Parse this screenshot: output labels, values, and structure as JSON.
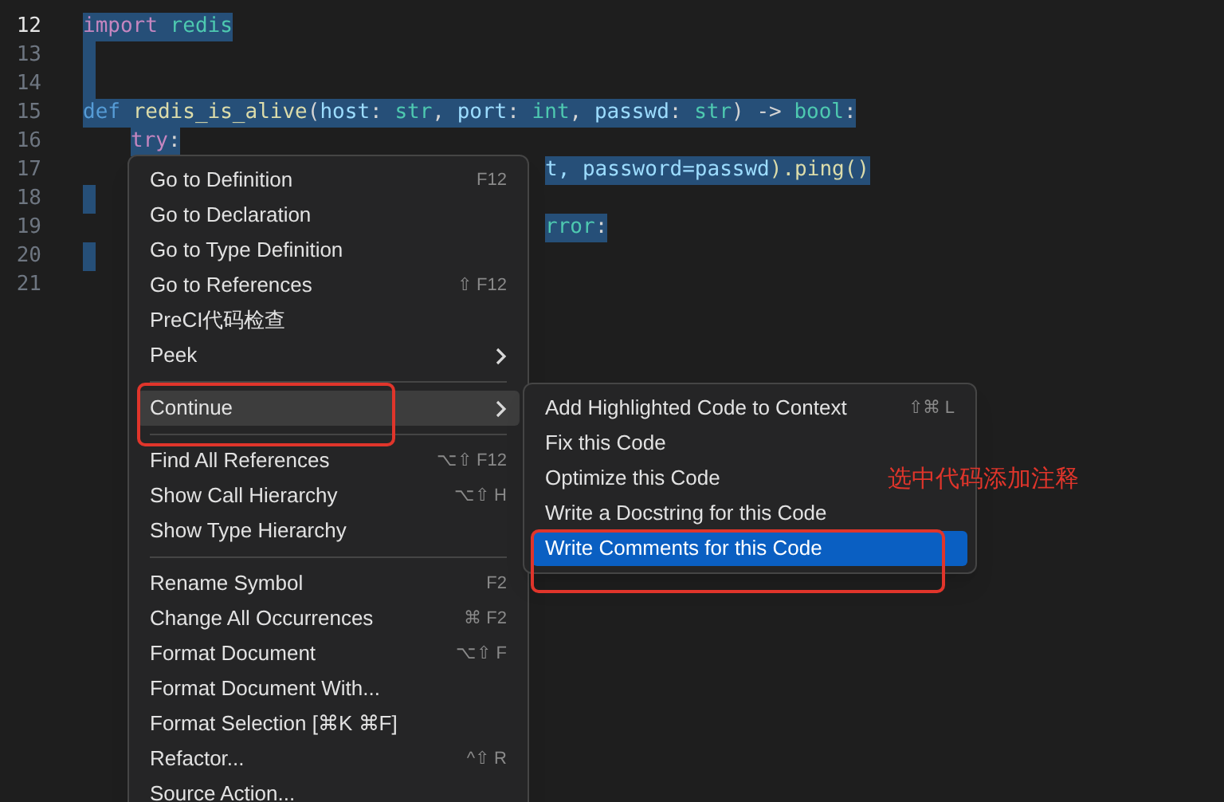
{
  "editor": {
    "lines": [
      {
        "number": "12",
        "current": true,
        "selected": true,
        "kind": "full",
        "segments": [
          {
            "kind": "keyword",
            "text": "import "
          },
          {
            "kind": "module",
            "text": "redis"
          }
        ]
      },
      {
        "number": "13",
        "current": false,
        "selected": true,
        "kind": "full"
      },
      {
        "number": "14",
        "current": false,
        "selected": true,
        "kind": "full"
      },
      {
        "number": "15",
        "current": false,
        "selected": true,
        "kind": "full",
        "segments": [
          {
            "kind": "storage",
            "text": "def "
          },
          {
            "kind": "function",
            "text": "redis_is_alive"
          },
          {
            "kind": "plain",
            "text": "("
          },
          {
            "kind": "param",
            "text": "host"
          },
          {
            "kind": "plain",
            "text": ": "
          },
          {
            "kind": "type",
            "text": "str"
          },
          {
            "kind": "plain",
            "text": ", "
          },
          {
            "kind": "param",
            "text": "port"
          },
          {
            "kind": "plain",
            "text": ": "
          },
          {
            "kind": "type",
            "text": "int"
          },
          {
            "kind": "plain",
            "text": ", "
          },
          {
            "kind": "param",
            "text": "passwd"
          },
          {
            "kind": "plain",
            "text": ": "
          },
          {
            "kind": "type",
            "text": "str"
          },
          {
            "kind": "plain",
            "text": ") -> "
          },
          {
            "kind": "type",
            "text": "bool"
          },
          {
            "kind": "plain",
            "text": ":"
          }
        ]
      },
      {
        "number": "16",
        "current": false,
        "selected": true,
        "kind": "indented",
        "segments": [
          {
            "kind": "keyword",
            "text": "try"
          },
          {
            "kind": "plain",
            "text": ":"
          }
        ]
      },
      {
        "number": "17",
        "current": false,
        "selected": true,
        "kind": "partial",
        "segments": [
          {
            "kind": "param",
            "text": "t, password=passwd"
          },
          {
            "kind": "function",
            "text": ").ping()"
          }
        ]
      },
      {
        "number": "18",
        "current": false,
        "selected": true,
        "kind": "full"
      },
      {
        "number": "19",
        "current": false,
        "selected": true,
        "kind": "partial",
        "segments": [
          {
            "kind": "type",
            "text": "rror"
          },
          {
            "kind": "plain",
            "text": ":"
          }
        ]
      },
      {
        "number": "20",
        "current": false,
        "selected": true,
        "kind": "full"
      },
      {
        "number": "21",
        "current": false,
        "selected": false,
        "kind": "full"
      }
    ]
  },
  "context_menu": {
    "items": [
      {
        "kind": "item",
        "label": "Go to Definition",
        "shortcut": "F12",
        "submenu": false,
        "selected": false
      },
      {
        "kind": "item",
        "label": "Go to Declaration",
        "submenu": false,
        "selected": false
      },
      {
        "kind": "item",
        "label": "Go to Type Definition",
        "submenu": false,
        "selected": false
      },
      {
        "kind": "item",
        "label": "Go to References",
        "shortcut": "⇧ F12",
        "submenu": false,
        "selected": false
      },
      {
        "kind": "item",
        "label": "PreCI代码检查",
        "submenu": false,
        "selected": false
      },
      {
        "kind": "item",
        "label": "Peek",
        "submenu": true,
        "selected": false
      },
      {
        "kind": "separator"
      },
      {
        "kind": "item",
        "label": "Continue",
        "submenu": true,
        "selected": true
      },
      {
        "kind": "separator"
      },
      {
        "kind": "item",
        "label": "Find All References",
        "shortcut": "⌥⇧ F12",
        "submenu": false,
        "selected": false
      },
      {
        "kind": "item",
        "label": "Show Call Hierarchy",
        "shortcut": "⌥⇧ H",
        "submenu": false,
        "selected": false
      },
      {
        "kind": "item",
        "label": "Show Type Hierarchy",
        "submenu": false,
        "selected": false
      },
      {
        "kind": "separator"
      },
      {
        "kind": "item",
        "label": "Rename Symbol",
        "shortcut": "F2",
        "submenu": false,
        "selected": false
      },
      {
        "kind": "item",
        "label": "Change All Occurrences",
        "shortcut": "⌘ F2",
        "submenu": false,
        "selected": false
      },
      {
        "kind": "item",
        "label": "Format Document",
        "shortcut": "⌥⇧ F",
        "submenu": false,
        "selected": false
      },
      {
        "kind": "item",
        "label": "Format Document With...",
        "submenu": false,
        "selected": false
      },
      {
        "kind": "item",
        "label": "Format Selection [⌘K ⌘F]",
        "submenu": false,
        "selected": false
      },
      {
        "kind": "item",
        "label": "Refactor...",
        "shortcut": "^⇧ R",
        "submenu": false,
        "selected": false
      },
      {
        "kind": "item",
        "label": "Source Action...",
        "submenu": false,
        "selected": false
      }
    ]
  },
  "submenu": {
    "items": [
      {
        "label": "Add Highlighted Code to Context",
        "shortcut": "⇧⌘ L",
        "selected": false
      },
      {
        "label": "Fix this Code",
        "selected": false
      },
      {
        "label": "Optimize this Code",
        "selected": false
      },
      {
        "label": "Write a Docstring for this Code",
        "selected": false
      },
      {
        "label": "Write Comments for this Code",
        "selected": true
      }
    ]
  },
  "annotation": {
    "note": "选中代码添加注释"
  }
}
